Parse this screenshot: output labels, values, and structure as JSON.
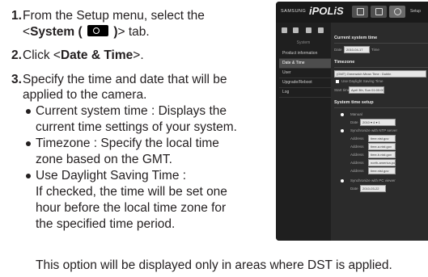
{
  "steps": [
    {
      "num": "1.",
      "line1": "From the Setup menu, select the",
      "prefix": "<",
      "bold": "System (",
      "bold_after": ")",
      "suffix": "> tab."
    },
    {
      "num": "2.",
      "pre": "Click <",
      "bold": "Date & Time",
      "post": ">."
    },
    {
      "num": "3.",
      "line1": "Specify the time and date that will be",
      "line2": "applied to the camera."
    }
  ],
  "bullets": [
    {
      "lines": [
        "Current system time : Displays the",
        "current time settings of your system."
      ]
    },
    {
      "lines": [
        "Timezone : Specify the local time",
        "zone based on the GMT."
      ]
    },
    {
      "lines": [
        "Use Daylight Saving Time :",
        "If checked, the time will be set one",
        "hour before the local time zone for",
        "the specified time period."
      ]
    }
  ],
  "note": "This option will be displayed only in areas where DST is applied.",
  "icons": {
    "system_chip": "gear-icon"
  },
  "screenshot": {
    "brand_small": "SAMSUNG",
    "brand_large": "iPOLiS",
    "top_label": "Setup",
    "sidebar_group": "System",
    "sidebar_items": [
      "Product information",
      "Date & Time",
      "User",
      "Upgrade/Reboot",
      "Log"
    ],
    "sections": {
      "current": "Current system time",
      "timezone": "Timezone",
      "setup": "System time setup"
    },
    "labels": {
      "date": "Date",
      "time": "Time",
      "start": "Start time",
      "manual": "Manual",
      "ntp": "Synchronize with NTP server",
      "pc": "Synchronize with PC viewer",
      "address": "Address",
      "dst": "Use Daylight Saving Time"
    },
    "values": {
      "date": "2010-04-17",
      "timezone": "(GMT) Greenwich Mean Time : Dublin",
      "start": "April 3th, Sun 01:00:00",
      "manual_date": "2010 ▾ 4 ▾ 1",
      "pc_date": "2010-03-22",
      "addresses": [
        "time.nist.gov",
        "time-a.nist.gov",
        "time-b.nist.gov",
        "north-america.pool",
        "time.nist.gov"
      ]
    }
  }
}
